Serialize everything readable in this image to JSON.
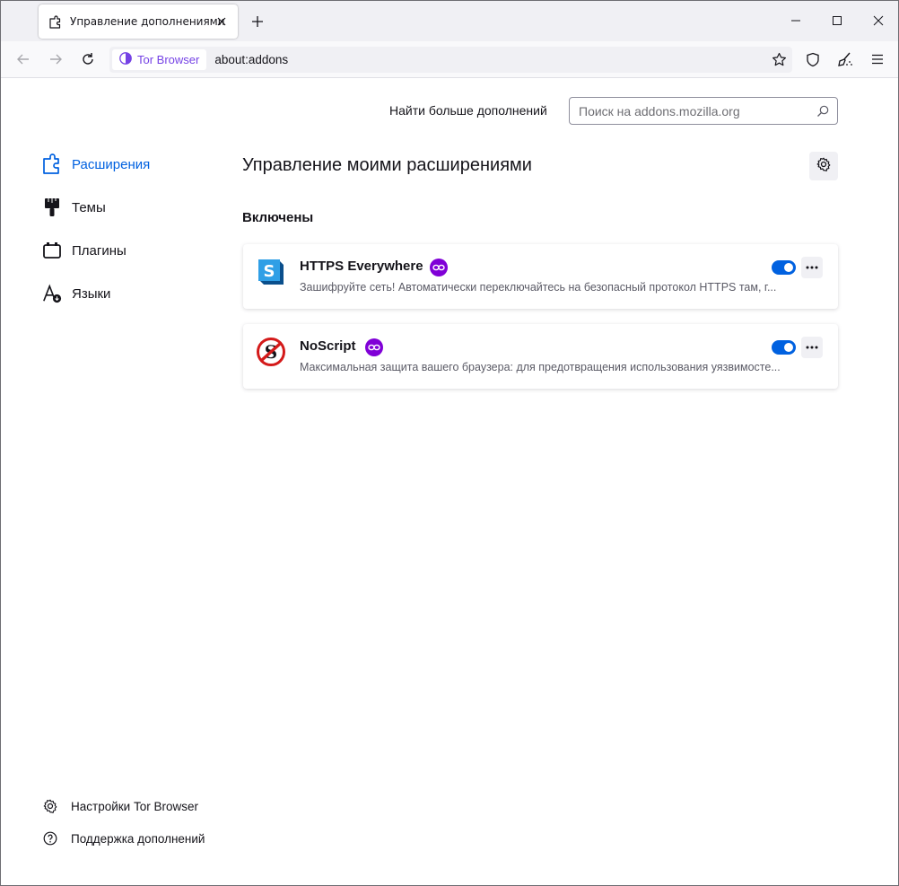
{
  "tab": {
    "title": "Управление дополнениями"
  },
  "navbar": {
    "identity_label": "Tor Browser",
    "url": "about:addons"
  },
  "search": {
    "label": "Найти больше дополнений",
    "placeholder": "Поиск на addons.mozilla.org"
  },
  "sidebar": {
    "items": [
      {
        "label": "Расширения",
        "icon": "puzzle-icon",
        "active": true
      },
      {
        "label": "Темы",
        "icon": "brush-icon"
      },
      {
        "label": "Плагины",
        "icon": "plugin-icon"
      },
      {
        "label": "Языки",
        "icon": "language-icon"
      }
    ],
    "footer": [
      {
        "label": "Настройки Tor Browser",
        "icon": "gear-icon"
      },
      {
        "label": "Поддержка дополнений",
        "icon": "help-icon"
      }
    ]
  },
  "main": {
    "title": "Управление моими расширениями",
    "section": "Включены",
    "addons": [
      {
        "name": "HTTPS Everywhere",
        "description": "Зашифруйте сеть! Автоматически переключайтесь на безопасный протокол HTTPS там, г...",
        "enabled": true,
        "icon": "https-everywhere-icon"
      },
      {
        "name": "NoScript",
        "description": "Максимальная защита вашего браузера: для предотвращения использования уязвимосте...",
        "enabled": true,
        "icon": "noscript-icon"
      }
    ]
  },
  "colors": {
    "accent": "#0061e0",
    "tor_purple": "#7542e5",
    "private_badge": "#8000d7"
  }
}
